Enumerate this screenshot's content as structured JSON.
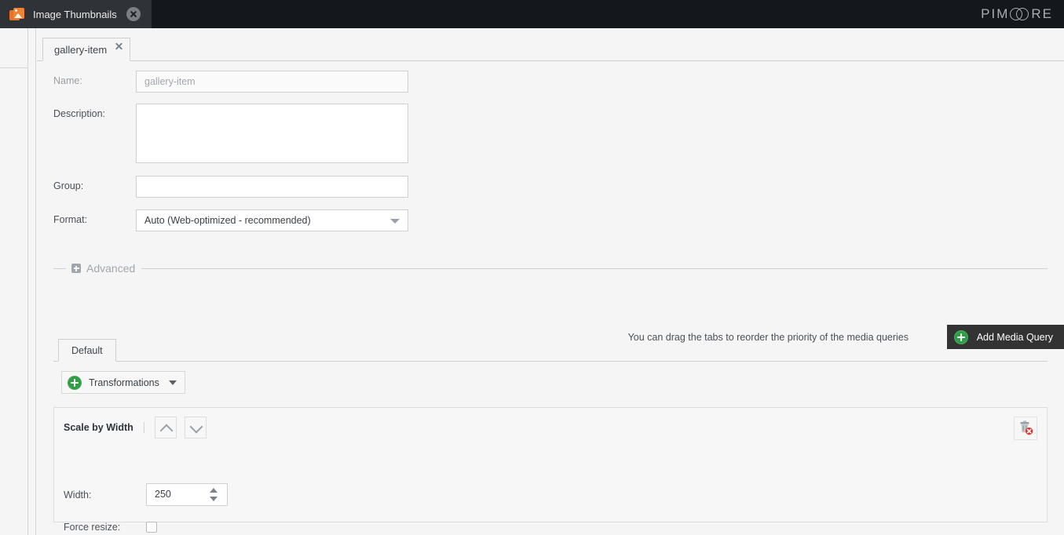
{
  "topbar": {
    "app_tab": {
      "icon": "image-stack-icon",
      "label": "Image Thumbnails",
      "close_icon": "close-circle-icon"
    },
    "brand": {
      "prefix": "PIM",
      "suffix": "RE",
      "full": "PIMCORE"
    }
  },
  "editor_tab": {
    "label": "gallery-item",
    "close_icon": "close-icon"
  },
  "form": {
    "name": {
      "label": "Name:",
      "value": "gallery-item",
      "readonly": true
    },
    "description": {
      "label": "Description:",
      "value": "",
      "placeholder": ""
    },
    "group": {
      "label": "Group:",
      "value": "",
      "placeholder": ""
    },
    "format": {
      "label": "Format:",
      "value": "Auto (Web-optimized - recommended)",
      "caret_icon": "chevron-down-icon"
    }
  },
  "advanced": {
    "label": "Advanced",
    "expand_icon": "plus-square-icon",
    "expanded": false
  },
  "media_queries": {
    "hint": "You can drag the tabs to reorder the priority of the media queries",
    "add_button": {
      "label": "Add Media Query",
      "icon": "plus-circle-icon"
    },
    "tabs": [
      {
        "label": "Default",
        "active": true
      }
    ]
  },
  "transformations_button": {
    "label": "Transformations",
    "icon": "plus-circle-icon",
    "caret_icon": "chevron-down-icon"
  },
  "transformation_panel": {
    "title": "Scale by Width",
    "move_up_icon": "chevron-up-icon",
    "move_down_icon": "chevron-down-icon",
    "delete_icon": "trash-delete-icon",
    "fields": {
      "width": {
        "label": "Width:",
        "value": "250"
      },
      "force_resize": {
        "label": "Force resize:",
        "checked": false
      }
    }
  },
  "colors": {
    "topbar_bg": "#14171c",
    "active_app_tab_bg": "#2f3338",
    "page_bg": "#f5f5f5",
    "accent_green": "#2f9e44",
    "accent_orange": "#f08432",
    "dark_button_bg": "#333333",
    "danger_red": "#e03131",
    "border": "#cfcfcf"
  }
}
